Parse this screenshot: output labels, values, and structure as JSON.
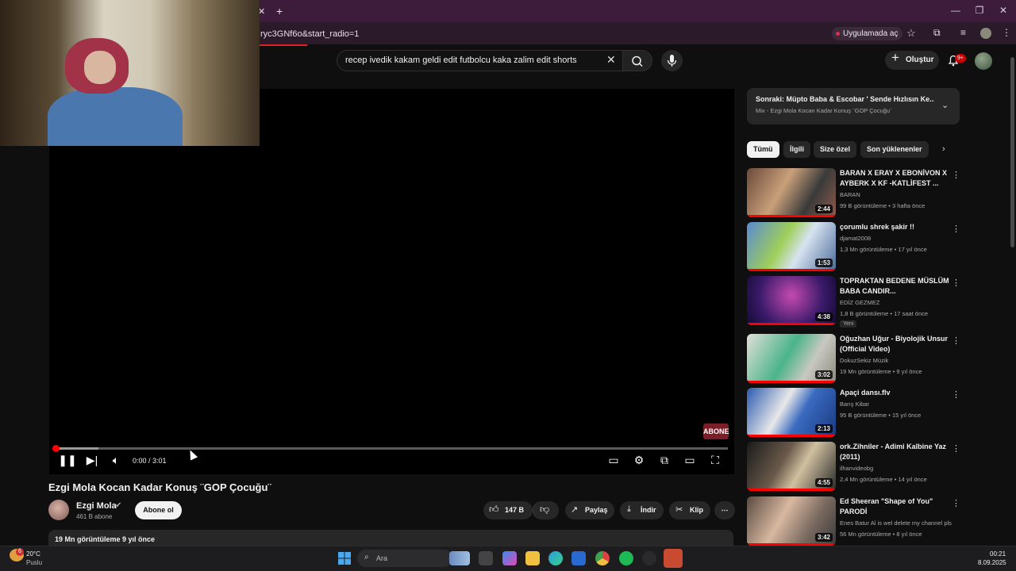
{
  "browser": {
    "url_fragment": "ryc3GNf6o&start_radio=1",
    "app_pill": "Uygulamada aç"
  },
  "header": {
    "search_value": "recep ivedik kakam geldi edit futbolcu kaka zalim edit shorts",
    "create_label": "Oluştur",
    "notif_count": "9+"
  },
  "player": {
    "time": "0:00 / 3:01",
    "watermark": "ABONE"
  },
  "video": {
    "title": "Ezgi Mola Kocan Kadar Konuş ¨GOP Çocuğu¨",
    "channel": "Ezgi Mola",
    "subscribers": "461 B abone",
    "subscribe_label": "Abone ol",
    "likes": "147 B",
    "share_label": "Paylaş",
    "download_label": "İndir",
    "clip_label": "Klip",
    "views_line": "19 Mn görüntüleme  9 yıl önce"
  },
  "sidebar": {
    "up_next_title": "Sonraki: Müpto Baba & Escobar ' Sende Hızlısın Ke...",
    "up_next_subtitle": "Mix - Ezgi Mola Kocan Kadar Konuş ¨GOP Çocuğu¨",
    "chips": [
      "Tümü",
      "İlgili",
      "Size özel",
      "Son yüklenenler"
    ],
    "recs": [
      {
        "title": "BARAN X ERAY X EBONİVON X AYBERK X KF -KATLİFEST ...",
        "channel": "BARAN",
        "meta": "99 B görüntüleme • 3 hafta önce",
        "duration": "2:44",
        "new": ""
      },
      {
        "title": "çorumlu shrek şakir !!",
        "channel": "djamat2008",
        "meta": "1,3 Mn görüntüleme • 17 yıl önce",
        "duration": "1:53",
        "new": ""
      },
      {
        "title": "TOPRAKTAN BEDENE MÜSLÜM BABA CANDIR...",
        "channel": "EDİZ GEZMEZ",
        "meta": "1,8 B görüntüleme • 17 saat önce",
        "duration": "4:38",
        "new": "Yeni"
      },
      {
        "title": "Oğuzhan Uğur - Biyolojik Unsur (Official Video)",
        "channel": "DokuzSekiz Müzik",
        "meta": "19 Mn görüntüleme • 9 yıl önce",
        "duration": "3:02",
        "new": ""
      },
      {
        "title": "Apaçi dansı.flv",
        "channel": "Barış Kibar",
        "meta": "95 B görüntüleme • 15 yıl önce",
        "duration": "2:13",
        "new": ""
      },
      {
        "title": "ork.Zihniler - Adimi Kalbine Yaz (2011)",
        "channel": "ilhanvideobg",
        "meta": "2,4 Mn görüntüleme • 14 yıl önce",
        "duration": "4:55",
        "new": ""
      },
      {
        "title": "Ed Sheeran  \"Shape of You\" PARODİ",
        "channel": "Enes Batur Al is wel delete my channel pls",
        "meta": "56 Mn görüntüleme • 8 yıl önce",
        "duration": "3:42",
        "new": ""
      }
    ]
  },
  "taskbar": {
    "weather_badge": "6",
    "weather_temp": "20°C",
    "weather_desc": "Puslu",
    "search_label": "Ara",
    "time": "00:21",
    "date": "8.09.2025"
  }
}
